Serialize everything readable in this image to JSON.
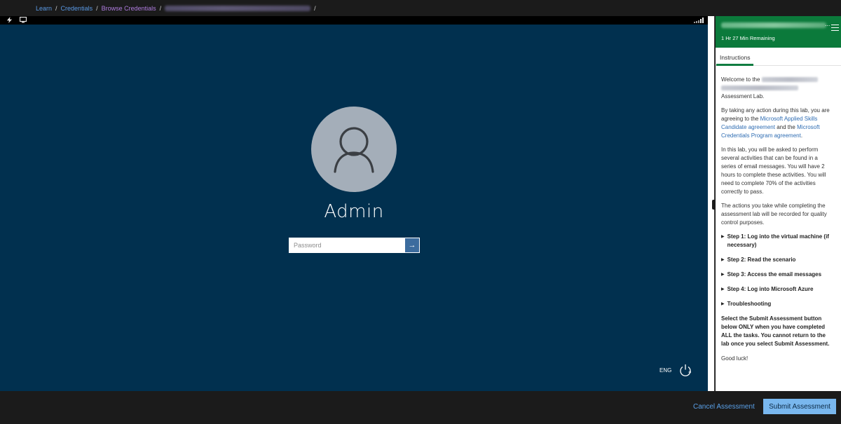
{
  "breadcrumb": {
    "items": [
      "Learn",
      "Credentials",
      "Browse Credentials"
    ],
    "separator": "/"
  },
  "vm": {
    "toolbar_icons": [
      "lightning-icon",
      "monitor-icon"
    ],
    "lock_screen": {
      "username": "Admin",
      "password_placeholder": "Password",
      "submit_arrow": "→",
      "language": "ENG"
    }
  },
  "panel": {
    "title_ellipsis": "...",
    "timer": "1 Hr 27 Min Remaining",
    "tab": "Instructions",
    "welcome_prefix": "Welcome to the",
    "welcome_suffix": "Assessment Lab.",
    "agreement_1": "By taking any action during this lab, you are agreeing to the",
    "link_candidate": "Microsoft Applied Skills Candidate agreement",
    "agreement_2": "and the",
    "link_program": "Microsoft Credentials Program agreement",
    "agreement_3": ".",
    "para_activities": "In this lab, you will be asked to perform several activities that can be found in a series of email messages. You will have 2 hours to complete these activities. You will need to complete 70% of the activities correctly to pass.",
    "para_recorded": "The actions you take while completing the assessment lab will be recorded for quality control purposes.",
    "steps": [
      "Step 1: Log into the virtual machine (if necessary)",
      "Step 2: Read the scenario",
      "Step 3: Access the email messages",
      "Step 4: Log into Microsoft Azure",
      "Troubleshooting"
    ],
    "submit_note": "Select the Submit Assessment button below ONLY when you have completed ALL the tasks. You cannot return to the lab once you select Submit Assessment.",
    "good_luck": "Good luck!"
  },
  "actions": {
    "cancel": "Cancel Assessment",
    "submit": "Submit Assessment"
  },
  "colors": {
    "vm_background": "#01304f",
    "panel_header": "#0b7a3b",
    "link": "#2f6db3",
    "submit_button": "#79b7ee"
  }
}
